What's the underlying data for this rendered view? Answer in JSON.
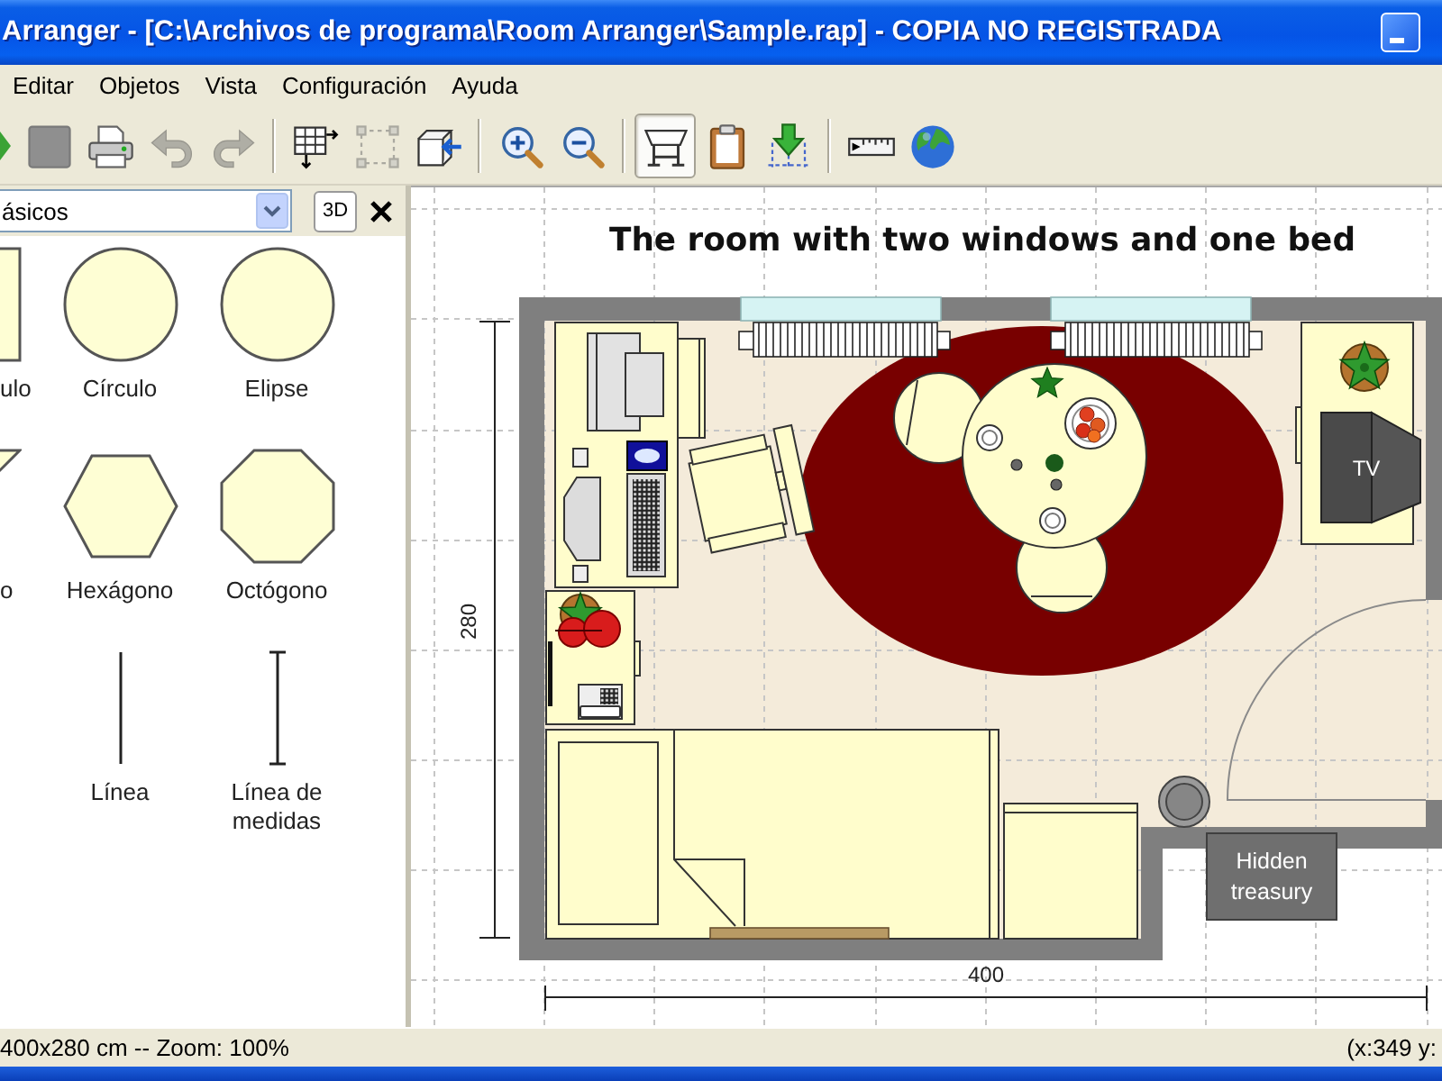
{
  "window": {
    "title": "Arranger - [C:\\Archivos de programa\\Room Arranger\\Sample.rap] - COPIA NO REGISTRADA"
  },
  "menu": [
    "Editar",
    "Objetos",
    "Vista",
    "Configuración",
    "Ayuda"
  ],
  "toolbar": [
    [
      {
        "disabled": false,
        "pressed": false
      },
      {
        "disabled": false,
        "pressed": false
      },
      {
        "disabled": false,
        "pressed": false
      },
      {
        "disabled": true,
        "pressed": false
      },
      {
        "disabled": true,
        "pressed": false
      }
    ],
    [
      {
        "disabled": false,
        "pressed": false
      },
      {
        "disabled": true,
        "pressed": false
      },
      {
        "disabled": false,
        "pressed": false
      }
    ],
    [
      {
        "disabled": false,
        "pressed": false
      },
      {
        "disabled": false,
        "pressed": false
      }
    ],
    [
      {
        "disabled": false,
        "pressed": true
      },
      {
        "disabled": false,
        "pressed": false
      },
      {
        "disabled": false,
        "pressed": false
      }
    ],
    [
      {
        "disabled": false,
        "pressed": false
      },
      {
        "disabled": false,
        "pressed": false
      }
    ]
  ],
  "panel": {
    "category": "ásicos",
    "view_button": "3D",
    "shapes": [
      [
        {
          "kind": "rectangle",
          "label": "ulo"
        },
        {
          "kind": "circle",
          "label": "Círculo"
        },
        {
          "kind": "ellipse",
          "label": "Elipse"
        }
      ],
      [
        {
          "kind": "triangle",
          "label": "o"
        },
        {
          "kind": "hexagon",
          "label": "Hexágono"
        },
        {
          "kind": "octagon",
          "label": "Octógono"
        }
      ],
      [
        {
          "kind": "line",
          "label": "Línea"
        },
        {
          "kind": "dimension",
          "label": "Línea de medidas"
        }
      ]
    ]
  },
  "canvas": {
    "title": "The room with two windows and one bed",
    "height_label": "280",
    "width_label": "400",
    "tv_label": "TV",
    "note": "Hidden treasury"
  },
  "status_bar": {
    "info": "400x280 cm -- Zoom: 100%",
    "coordinates": "(x:349 y:"
  }
}
